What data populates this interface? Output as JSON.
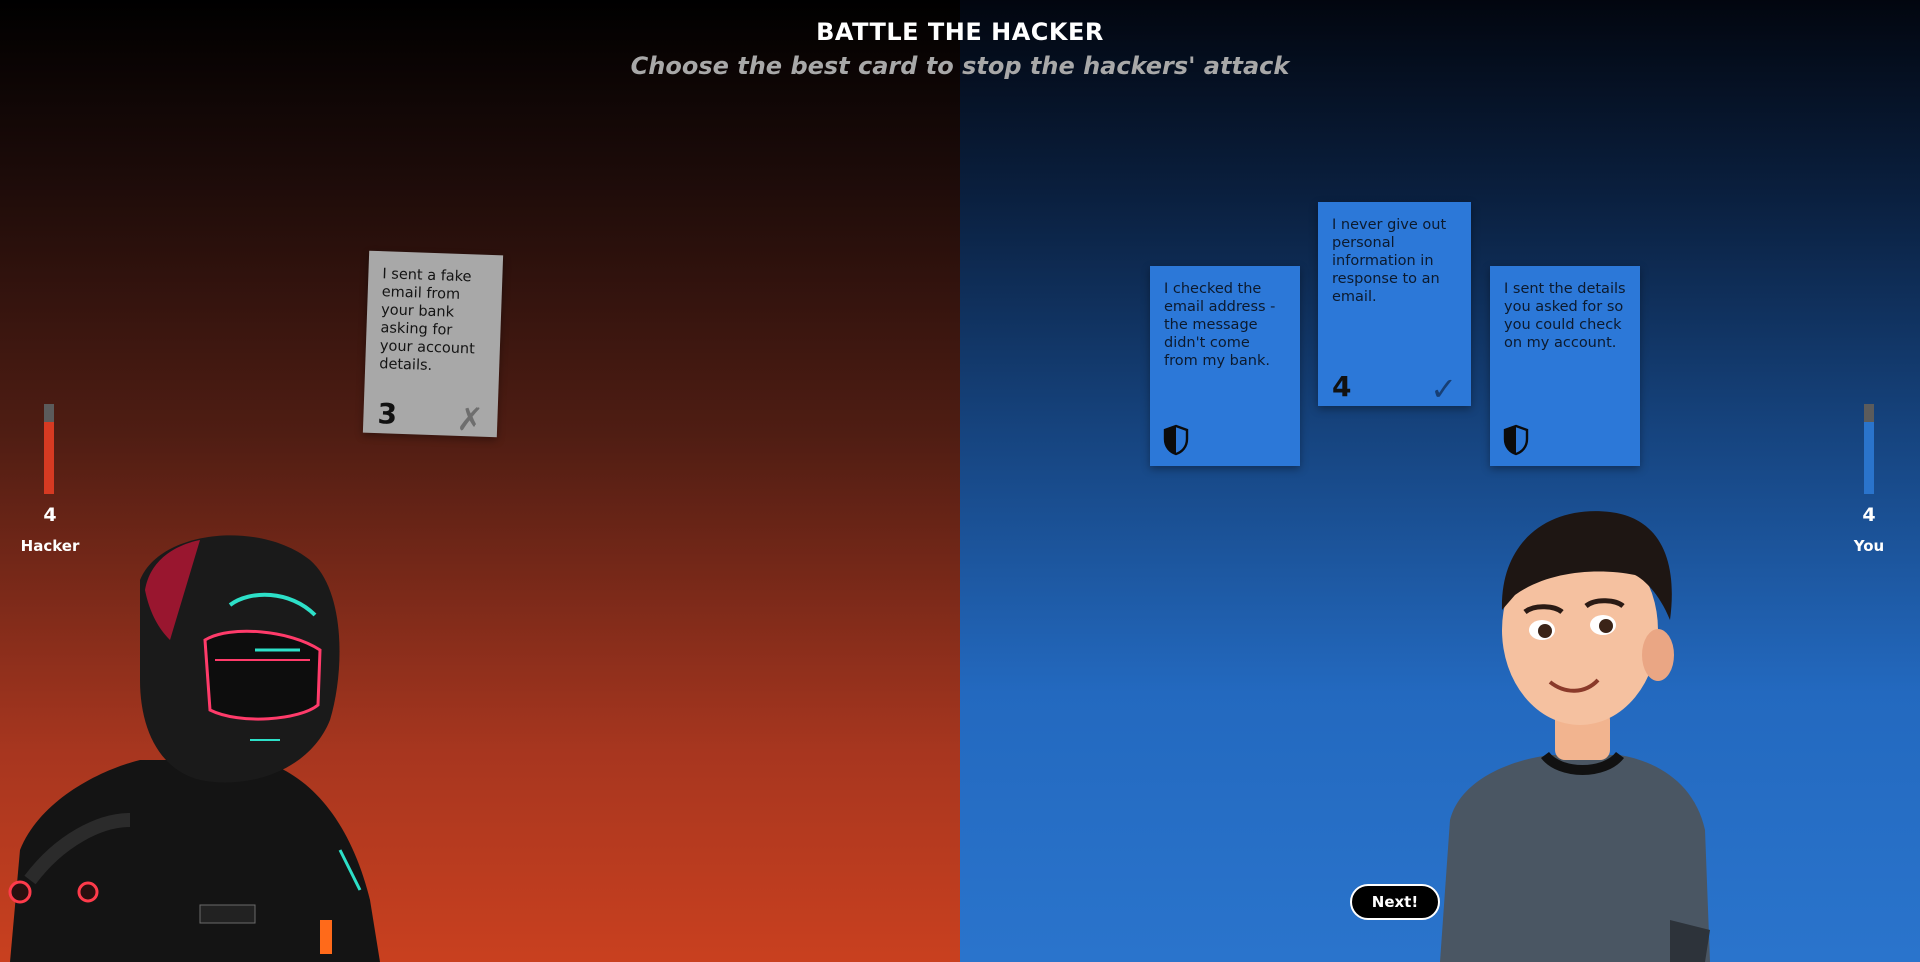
{
  "header": {
    "title": "BATTLE THE HACKER",
    "subtitle": "Choose the best card to stop the hackers' attack"
  },
  "hacker": {
    "label": "Hacker",
    "score": "4",
    "meter_level": 0.8,
    "card": {
      "text": "I sent a fake email from your bank asking for your account details.",
      "value": "3",
      "mark": "✗"
    }
  },
  "player": {
    "label": "You",
    "score": "4",
    "meter_level": 0.8,
    "cards": [
      {
        "text": "I checked the email address - the message didn't come from my bank.",
        "icon": "shield-icon"
      },
      {
        "text": "I never give out personal information in response to an email.",
        "value": "4",
        "mark": "✓"
      },
      {
        "text": "I sent the details you asked for so you could check on my account.",
        "icon": "shield-icon"
      }
    ]
  },
  "actions": {
    "next_label": "Next!"
  },
  "colors": {
    "hacker_red": "#d63a22",
    "player_blue": "#2a74cc",
    "card_blue": "#2c78d8",
    "card_grey": "#a8a8a8"
  }
}
